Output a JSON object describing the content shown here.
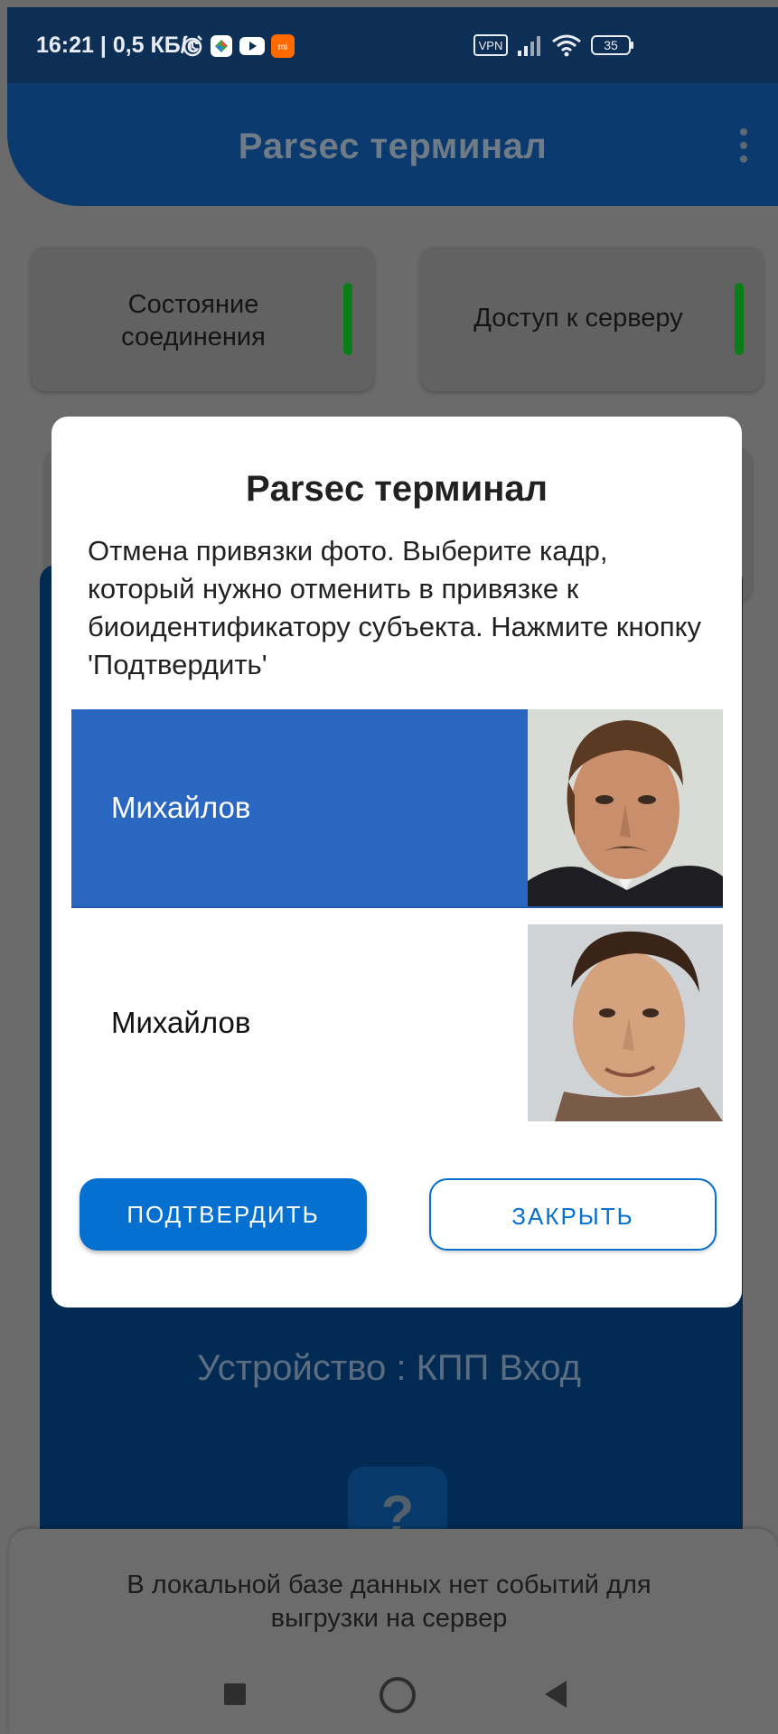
{
  "status_bar": {
    "time": "16:21 | 0,5 КБ/с",
    "vpn_label": "VPN",
    "battery": "35",
    "icons": [
      "alarm-icon",
      "app-icon",
      "youtube-icon",
      "mi-icon",
      "vpn-icon",
      "signal-icon",
      "wifi-icon",
      "battery-icon"
    ]
  },
  "app_bar": {
    "title": "Parsec терминал",
    "menu_icon": "more-vert-icon"
  },
  "cards": {
    "connection": "Состояние соединения",
    "server_access": "Доступ к серверу"
  },
  "device": "Устройство : КПП Вход",
  "help_label": "?",
  "bottom_message": "В локальной базе данных нет событий для выгрузки на сервер",
  "dialog": {
    "title": "Parsec терминал",
    "message": "Отмена привязки фото. Выберите кадр, который нужно отменить в привязке к биоидентификатору субъекта. Нажмите кнопку 'Подтвердить'",
    "items": [
      {
        "name": "Михайлов",
        "selected": true
      },
      {
        "name": "Михайлов",
        "selected": false
      }
    ],
    "confirm_label": "ПОДТВЕРДИТЬ",
    "close_label": "ЗАКРЫТЬ"
  },
  "colors": {
    "accent": "#0670d0",
    "selected_row": "#2a67c1",
    "status_bar": "#0d2f55",
    "app_bar": "#0a3a6e",
    "indicator_green": "#0a7d17"
  }
}
